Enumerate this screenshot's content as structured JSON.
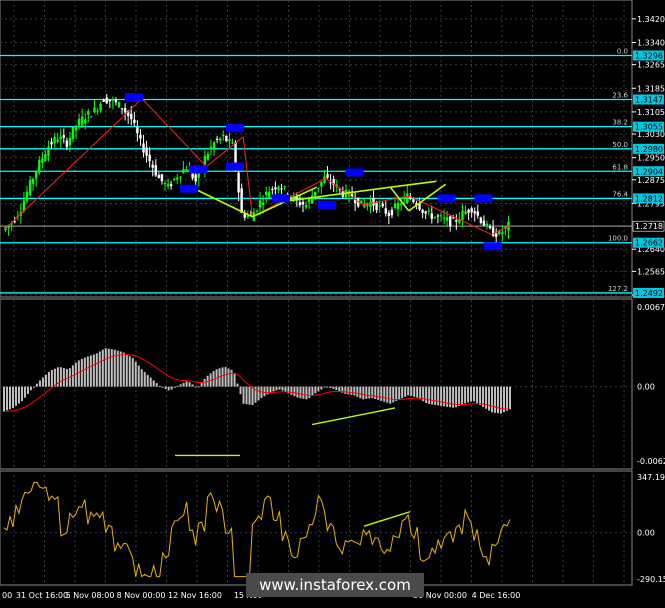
{
  "colors": {
    "background": "#000000",
    "grid": "#3a3a3a",
    "bull_candle": "#00ff00",
    "bear_candle": "#ffffff",
    "fib_line": "#00ffff",
    "zigzag": "#ff2020",
    "trendline": "#b5ff00",
    "blue_box": "#0000ff",
    "macd_hist": "#c0c0c0",
    "macd_signal": "#ff0000",
    "cci": "#e8b400",
    "axis_text": "#ffffff"
  },
  "main": {
    "price_ticks": [
      "1.3420",
      "1.3340",
      "1.3265",
      "1.3185",
      "1.3105",
      "1.3030",
      "1.2950",
      "1.2875",
      "1.2795",
      "1.2640",
      "1.2565",
      "1.2485"
    ],
    "current_price": "1.2718",
    "fib_levels": [
      {
        "ratio": "0.0",
        "price": "1.3296"
      },
      {
        "ratio": "23.6",
        "price": "1.3147"
      },
      {
        "ratio": "38.2",
        "price": "1.3055"
      },
      {
        "ratio": "50.0",
        "price": "1.2980"
      },
      {
        "ratio": "61.8",
        "price": "1.2904"
      },
      {
        "ratio": "76.4",
        "price": "1.2812"
      },
      {
        "ratio": "100.0",
        "price": "1.2662"
      },
      {
        "ratio": "127.2",
        "price": "1.2492"
      }
    ]
  },
  "macd": {
    "ticks": [
      "0.00671",
      "0.00",
      "-0.00627"
    ]
  },
  "cci": {
    "ticks": [
      "347.1984",
      "0.00",
      "-290.156"
    ]
  },
  "x_axis": {
    "labels": [
      "00",
      "31 Oct 16:00",
      "5 Nov 08:00",
      "8 Nov 00:00",
      "12 Nov 16:00",
      "15 Nov",
      "",
      "30 Nov 00:00",
      "4 Dec 16:00"
    ]
  },
  "watermark": "www.instaforex.com",
  "chart_data": {
    "type": "candlestick",
    "symbol_hint": "",
    "price_axis": {
      "min": 1.2485,
      "max": 1.345
    },
    "x_labels": [
      "31 Oct 16:00",
      "5 Nov 08:00",
      "8 Nov 00:00",
      "12 Nov 16:00",
      "15 Nov",
      "30 Nov 00:00",
      "4 Dec 16:00"
    ],
    "approx_close_path": [
      1.2705,
      1.273,
      1.278,
      1.286,
      1.293,
      1.299,
      1.302,
      1.3,
      1.306,
      1.309,
      1.311,
      1.315,
      1.314,
      1.312,
      1.308,
      1.3,
      1.294,
      1.288,
      1.285,
      1.289,
      1.292,
      1.287,
      1.295,
      1.3,
      1.302,
      1.299,
      1.276,
      1.275,
      1.28,
      1.284,
      1.286,
      1.283,
      1.28,
      1.279,
      1.284,
      1.288,
      1.286,
      1.283,
      1.282,
      1.279,
      1.28,
      1.278,
      1.276,
      1.279,
      1.282,
      1.28,
      1.276,
      1.275,
      1.274,
      1.273,
      1.276,
      1.278,
      1.274,
      1.27,
      1.269,
      1.272
    ],
    "fibonacci": [
      {
        "level": 0.0,
        "price": 1.3296
      },
      {
        "level": 23.6,
        "price": 1.3147
      },
      {
        "level": 38.2,
        "price": 1.3055
      },
      {
        "level": 50.0,
        "price": 1.298
      },
      {
        "level": 61.8,
        "price": 1.2904
      },
      {
        "level": 76.4,
        "price": 1.2812
      },
      {
        "level": 100.0,
        "price": 1.2662
      },
      {
        "level": 127.2,
        "price": 1.2492
      }
    ],
    "last_price": 1.2718,
    "macd_range": [
      -0.00627,
      0.00671
    ],
    "cci_range": [
      -290.156,
      347.1984
    ]
  }
}
